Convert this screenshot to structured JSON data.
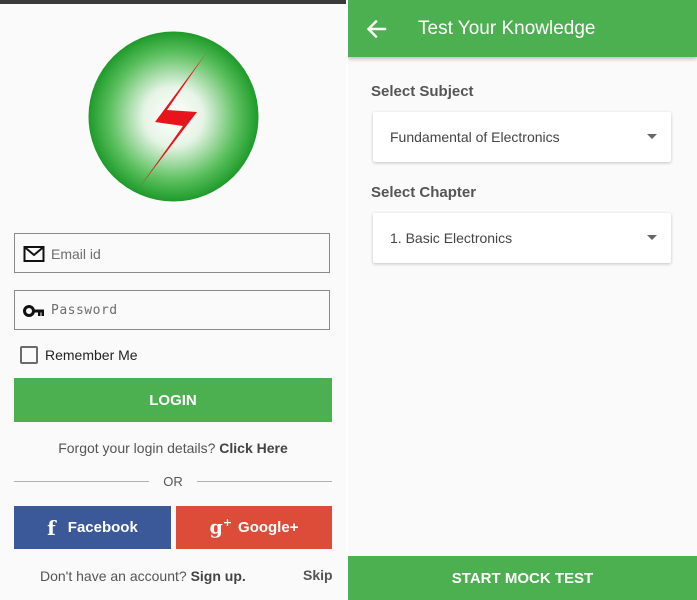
{
  "login": {
    "logo_icon": "lightning-bolt-logo",
    "email": {
      "placeholder": "Email id",
      "icon": "mail-icon"
    },
    "password": {
      "placeholder": "Password",
      "icon": "key-icon"
    },
    "remember_label": "Remember Me",
    "login_button": "LOGIN",
    "forgot_text": "Forgot your login details?",
    "forgot_link": "Click Here",
    "or_text": "OR",
    "facebook_button": "Facebook",
    "google_button": "Google+",
    "signup_text": "Don't have an account?",
    "signup_link": "Sign up.",
    "skip": "Skip",
    "colors": {
      "accent": "#4caf50",
      "facebook": "#3b5998",
      "google": "#dd4b39"
    }
  },
  "quiz": {
    "title": "Test Your Knowledge",
    "back_icon": "arrow-left-icon",
    "subject_label": "Select Subject",
    "subject_value": "Fundamental of Electronics",
    "chapter_label": "Select Chapter",
    "chapter_value": "1. Basic Electronics",
    "start_button": "START MOCK TEST",
    "colors": {
      "appbar": "#4caf50"
    }
  }
}
